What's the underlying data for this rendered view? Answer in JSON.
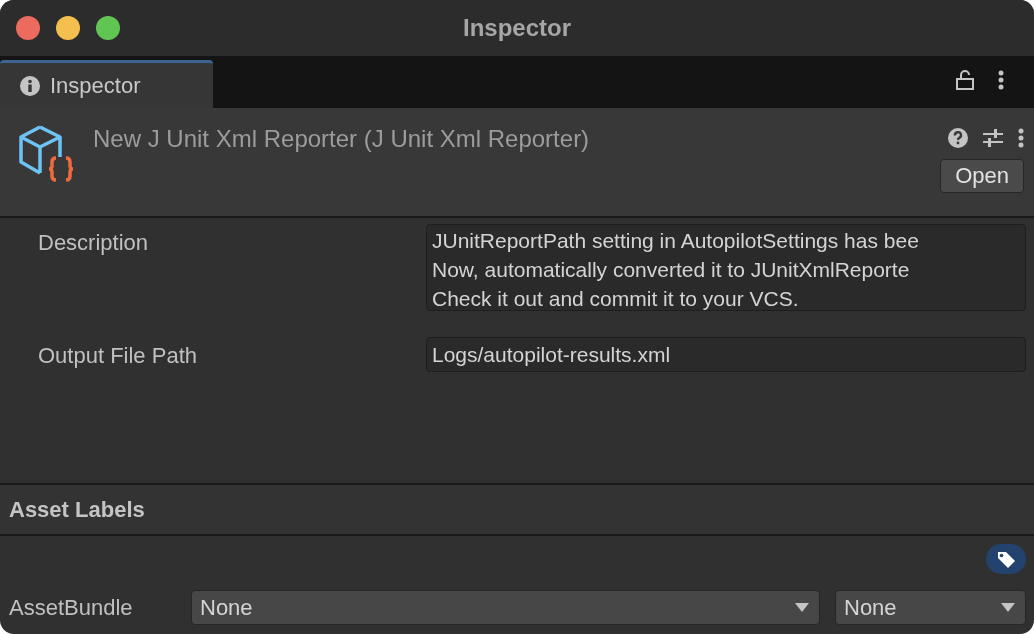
{
  "window": {
    "title": "Inspector"
  },
  "tabs": [
    {
      "label": "Inspector",
      "selected": true
    }
  ],
  "header": {
    "title": "New J Unit Xml Reporter (J Unit Xml Reporter)",
    "button": "Open"
  },
  "fields": [
    {
      "kind": "textarea",
      "label": "Description",
      "value": "JUnitReportPath setting in AutopilotSettings has bee\nNow, automatically converted it to JUnitXmlReporte\nCheck it out and commit it to your VCS."
    },
    {
      "kind": "text",
      "label": "Output File Path",
      "value": "Logs/autopilot-results.xml"
    }
  ],
  "asset_labels": {
    "title": "Asset Labels",
    "asset_bundle": {
      "label": "AssetBundle",
      "dropdowns": [
        "None",
        "None"
      ]
    }
  }
}
